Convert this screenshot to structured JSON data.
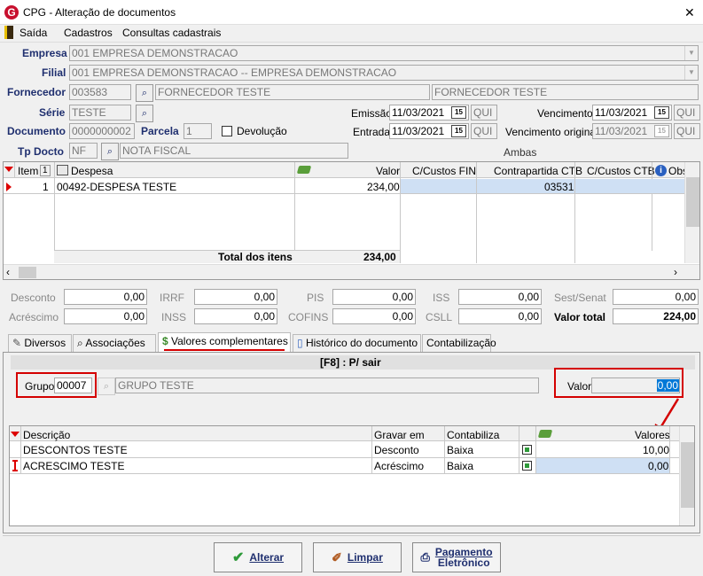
{
  "window": {
    "title": "CPG - Alteração de documentos",
    "close": "✕"
  },
  "menu": {
    "items": [
      "Saída",
      "Cadastros",
      "Consultas cadastrais"
    ]
  },
  "header": {
    "empresa_label": "Empresa",
    "empresa_value": "001 EMPRESA DEMONSTRACAO",
    "filial_label": "Filial",
    "filial_value": "001 EMPRESA DEMONSTRACAO -- EMPRESA DEMONSTRACAO",
    "fornecedor_label": "Fornecedor",
    "fornecedor_code": "003583",
    "fornecedor_name1": "FORNECEDOR TESTE",
    "fornecedor_name2": "FORNECEDOR TESTE",
    "serie_label": "Série",
    "serie_value": "TESTE",
    "documento_label": "Documento",
    "documento_value": "0000000002",
    "parcela_label": "Parcela",
    "parcela_value": "1",
    "devolucao_label": "Devolução",
    "tpdocto_label": "Tp Docto",
    "tpdocto_code": "NF",
    "tpdocto_name": "NOTA FISCAL",
    "emissao_label": "Emissão",
    "emissao_value": "11/03/2021",
    "emissao_day": "QUI",
    "entrada_label": "Entrada",
    "entrada_value": "11/03/2021",
    "entrada_day": "QUI",
    "vencimento_label": "Vencimento",
    "vencimento_value": "11/03/2021",
    "vencimento_day": "QUI",
    "vencorig_label": "Vencimento original",
    "vencorig_value": "11/03/2021",
    "vencorig_day": "QUI",
    "ambas": "Ambas",
    "cal_icon": "15"
  },
  "items_grid": {
    "columns": [
      "Item",
      "1",
      "Despesa",
      "Valor",
      "C/Custos FIN",
      "Contrapartida CTB",
      "C/Custos CTB",
      "Obs"
    ],
    "rows": [
      {
        "item": "1",
        "despesa": "00492-DESPESA TESTE",
        "valor": "234,00",
        "contrapartida": "03531"
      }
    ],
    "total_label": "Total dos itens",
    "total_value": "234,00"
  },
  "totals": {
    "desconto_label": "Desconto",
    "desconto": "0,00",
    "acrescimo_label": "Acréscimo",
    "acrescimo": "0,00",
    "irrf_label": "IRRF",
    "irrf": "0,00",
    "inss_label": "INSS",
    "inss": "0,00",
    "pis_label": "PIS",
    "pis": "0,00",
    "cofins_label": "COFINS",
    "cofins": "0,00",
    "iss_label": "ISS",
    "iss": "0,00",
    "csll_label": "CSLL",
    "csll": "0,00",
    "sestsenat_label": "Sest/Senat",
    "sestsenat": "0,00",
    "valortotal_label": "Valor total",
    "valortotal": "224,00"
  },
  "tabs": [
    "Diversos",
    "Associações",
    "Valores complementares",
    "Histórico do documento",
    "Contabilização"
  ],
  "panel": {
    "hint": "[F8] : P/ sair",
    "grupo_label": "Grupo",
    "grupo_code": "00007",
    "grupo_name": "GRUPO TESTE",
    "valor_label": "Valor",
    "valor_value": "0,00"
  },
  "comp_grid": {
    "columns": [
      "Descrição",
      "Gravar em",
      "Contabiliza",
      "Valores"
    ],
    "rows": [
      {
        "descricao": "DESCONTOS TESTE",
        "gravar": "Desconto",
        "contabiliza": "Baixa",
        "valor": "10,00"
      },
      {
        "descricao": "ACRESCIMO TESTE",
        "gravar": "Acréscimo",
        "contabiliza": "Baixa",
        "valor": "0,00"
      }
    ]
  },
  "buttons": {
    "alterar": "Alterar",
    "limpar": "Limpar",
    "pagamento_1": "Pagamento",
    "pagamento_2": "Eletrônico"
  },
  "colors": {
    "label_blue": "#1f2f6f",
    "highlight_red": "#d40000",
    "selection_blue": "#0078d7"
  }
}
